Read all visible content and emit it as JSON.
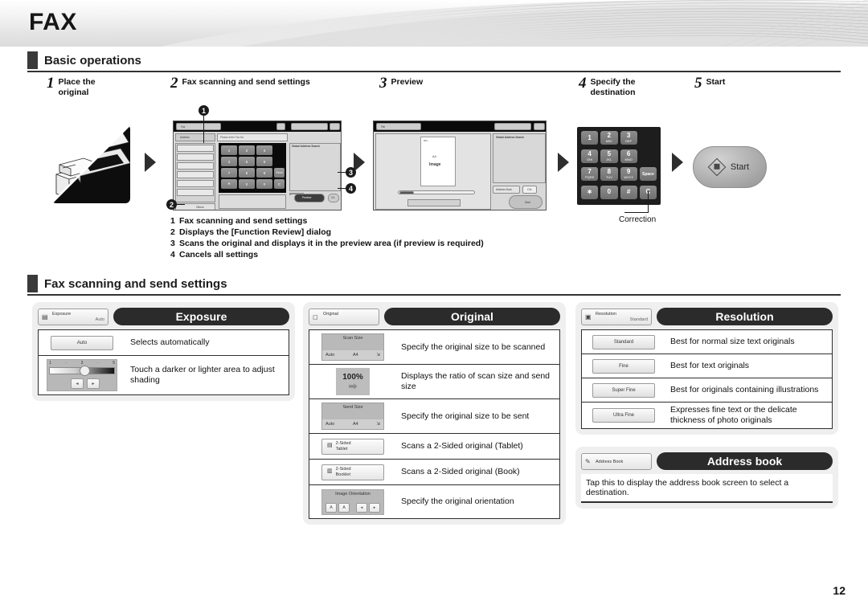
{
  "header": {
    "title": "FAX"
  },
  "sections": {
    "basic": {
      "title": "Basic operations"
    },
    "fax_settings": {
      "title": "Fax scanning and send settings"
    }
  },
  "steps": [
    {
      "num": "1",
      "label": "Place the\noriginal",
      "line1": "Place the",
      "line2": "original"
    },
    {
      "num": "2",
      "label": "Fax scanning and send settings",
      "line1": "Fax scanning and send settings",
      "line2": ""
    },
    {
      "num": "3",
      "label": "Preview",
      "line1": "Preview",
      "line2": ""
    },
    {
      "num": "4",
      "label": "Specify the\ndestination",
      "line1": "Specify the",
      "line2": "destination"
    },
    {
      "num": "5",
      "label": "Start",
      "line1": "Start",
      "line2": ""
    }
  ],
  "callouts": {
    "one": "1",
    "two": "2",
    "three": "3",
    "four": "4"
  },
  "notes": [
    {
      "n": "1",
      "text": "Fax scanning and send settings"
    },
    {
      "n": "2",
      "text": "Displays the [Function Review] dialog"
    },
    {
      "n": "3",
      "text": "Scans the original and displays it in the preview area (if preview is required)"
    },
    {
      "n": "4",
      "text": "Cancels all settings"
    }
  ],
  "keypad": {
    "keys": [
      {
        "main": "1",
        "sub": ""
      },
      {
        "main": "2",
        "sub": "ABC"
      },
      {
        "main": "3",
        "sub": "DEF"
      },
      {
        "main": "",
        "sub": ""
      },
      {
        "main": "4",
        "sub": "GHI"
      },
      {
        "main": "5",
        "sub": "JKL"
      },
      {
        "main": "6",
        "sub": "MNO"
      },
      {
        "main": "",
        "sub": ""
      },
      {
        "main": "7",
        "sub": "PQRS"
      },
      {
        "main": "8",
        "sub": "TUV"
      },
      {
        "main": "9",
        "sub": "WXYZ"
      },
      {
        "main": "Space",
        "sub": ""
      },
      {
        "main": "∗",
        "sub": ""
      },
      {
        "main": "0",
        "sub": ""
      },
      {
        "main": "#",
        "sub": ""
      },
      {
        "main": "C",
        "sub": ""
      }
    ],
    "correction_label": "Correction"
  },
  "start_button": {
    "label": "Start"
  },
  "preview_screen": {
    "page_no": "001",
    "paper_size": "A4",
    "image_label": "Image",
    "panel_title": "Global Address Search",
    "buttons": {
      "cancel_all": "CA",
      "address_book": "Address Book",
      "start": "Start",
      "file": "File"
    }
  },
  "send_screen": {
    "title": "Fax",
    "address_placeholder": "Please enter Fax No.",
    "tab_address": "Address",
    "panel_title": "Global Address Search",
    "buttons": {
      "preview": "Preview",
      "cancel_all": "CA",
      "send": "Send",
      "clear": "C",
      "others": "Others",
      "speaker": "Speaker"
    }
  },
  "cards": {
    "exposure": {
      "title": "Exposure",
      "key": {
        "label": "Exposure",
        "value": "Auto",
        "icon": "exposure-icon"
      },
      "rows": [
        {
          "widget": "auto-button",
          "widget_label": "Auto",
          "desc": "Selects automatically"
        },
        {
          "widget": "exposure-slider",
          "widget_label": "",
          "desc": "Touch a darker or lighter area to adjust shading",
          "ticks": [
            "1",
            "·",
            "3",
            "·",
            "5"
          ]
        }
      ]
    },
    "original": {
      "title": "Original",
      "key": {
        "label": "Original",
        "value": "",
        "icon": "original-icon"
      },
      "rows": [
        {
          "widget": "scan-size-tile",
          "caption": "Scan Size",
          "left": "Auto",
          "mid": "A4",
          "desc": "Specify the original size to be scanned"
        },
        {
          "widget": "ratio-tile",
          "caption": "100%",
          "desc": "Displays the ratio of scan size and send size"
        },
        {
          "widget": "send-size-tile",
          "caption": "Send Size",
          "left": "Auto",
          "mid": "A4",
          "desc": "Specify the original size to be sent"
        },
        {
          "widget": "two-sided-tablet-button",
          "line1": "2-Sided",
          "line2": "Tablet",
          "desc": "Scans a 2-Sided original (Tablet)"
        },
        {
          "widget": "two-sided-booklet-button",
          "line1": "2-Sided",
          "line2": "Booklet",
          "desc": "Scans a 2-Sided original (Book)"
        },
        {
          "widget": "image-orientation-tile",
          "caption": "Image Orientation",
          "desc": "Specify the original orientation"
        }
      ]
    },
    "resolution": {
      "title": "Resolution",
      "key": {
        "label": "Resolution",
        "value": "Standard",
        "icon": "resolution-icon"
      },
      "rows": [
        {
          "widget_label": "Standard",
          "desc": "Best for normal size text originals"
        },
        {
          "widget_label": "Fine",
          "desc": "Best for text originals"
        },
        {
          "widget_label": "Super Fine",
          "desc": "Best for originals containing illustrations"
        },
        {
          "widget_label": "Ultra Fine",
          "desc": "Expresses fine text or the delicate thickness of photo originals"
        }
      ]
    },
    "address_book": {
      "title": "Address book",
      "key": {
        "label": "Address Book",
        "value": "",
        "icon": "address-book-icon"
      },
      "desc": "Tap this to display the address book screen to select a destination."
    }
  },
  "footer": {
    "page_number": "12"
  },
  "colors": {
    "accent_dark": "#2b2b2b",
    "panel_bg": "#efefef",
    "rule": "#333333"
  }
}
